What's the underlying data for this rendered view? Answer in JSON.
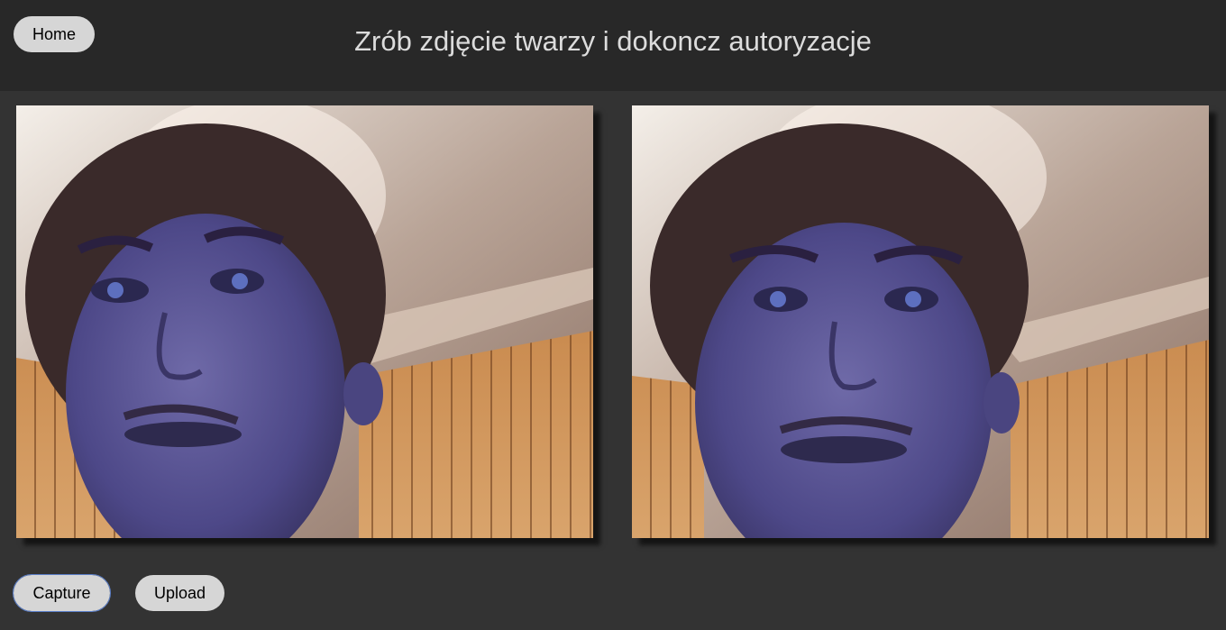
{
  "header": {
    "home_label": "Home",
    "title": "Zrób zdjęcie twarzy i dokoncz autoryzacje"
  },
  "frames": {
    "live_feed": "webcam-live-view",
    "captured": "captured-photo"
  },
  "actions": {
    "capture_label": "Capture",
    "upload_label": "Upload"
  },
  "colors": {
    "header_bg": "#282828",
    "page_bg": "#333333",
    "button_bg": "#d6d6d6",
    "focus_outline": "#5b7fc9"
  }
}
